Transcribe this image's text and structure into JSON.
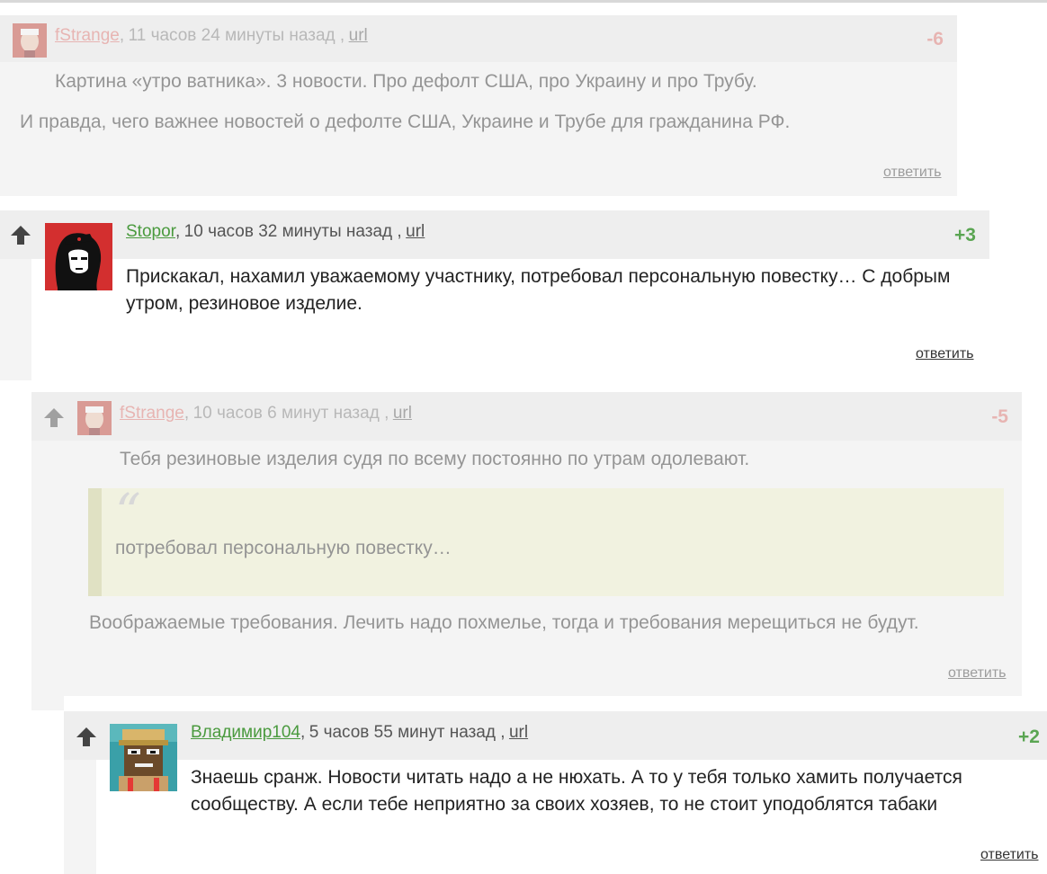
{
  "colors": {
    "negative": "#e0706a",
    "positive": "#5aa552",
    "author_neg": "#e0706a",
    "author_pos": "#4a9a3e"
  },
  "comments": [
    {
      "author": "fStrange",
      "sep": ",",
      "time": "11 часов 24 минуты назад ,",
      "url_label": "url",
      "score": "-6",
      "paragraphs": [
        "Картина «утро ватника». 3 новости. Про дефолт США, про Украину и про Трубу.",
        "И правда, чего важнее новостей о  дефолте США, Украине и Трубе для гражданина РФ."
      ],
      "reply_label": "ответить"
    },
    {
      "author": "Stopor",
      "sep": ",",
      "time": "10 часов 32 минуты назад ,",
      "url_label": "url",
      "score": "+3",
      "paragraphs": [
        "Прискакал, нахамил уважаемому участнику, потребовал персональную повестку… С добрым утром, резиновое изделие."
      ],
      "reply_label": "ответить"
    },
    {
      "author": "fStrange",
      "sep": ",",
      "time": "10 часов 6 минут назад ,",
      "url_label": "url",
      "score": "-5",
      "paragraphs": [
        "Тебя резиновые изделия судя по всему постоянно по утрам одолевают.",
        "Воображаемые требования. Лечить надо похмелье, тогда и требования мерещиться не будут."
      ],
      "quote_mark": "“",
      "quote": "потребовал персональную повестку…",
      "reply_label": "ответить"
    },
    {
      "author": "Владимир104",
      "sep": ",",
      "time": "5 часов 55 минут назад ,",
      "url_label": "url",
      "score": "+2",
      "paragraphs": [
        "Знаешь сранж. Новости читать надо а не нюхать. А то у тебя только хамить получается сообществу. А если тебе неприятно за своих хозяев, то не стоит уподоблятся табаки"
      ],
      "reply_label": "ответить"
    }
  ]
}
